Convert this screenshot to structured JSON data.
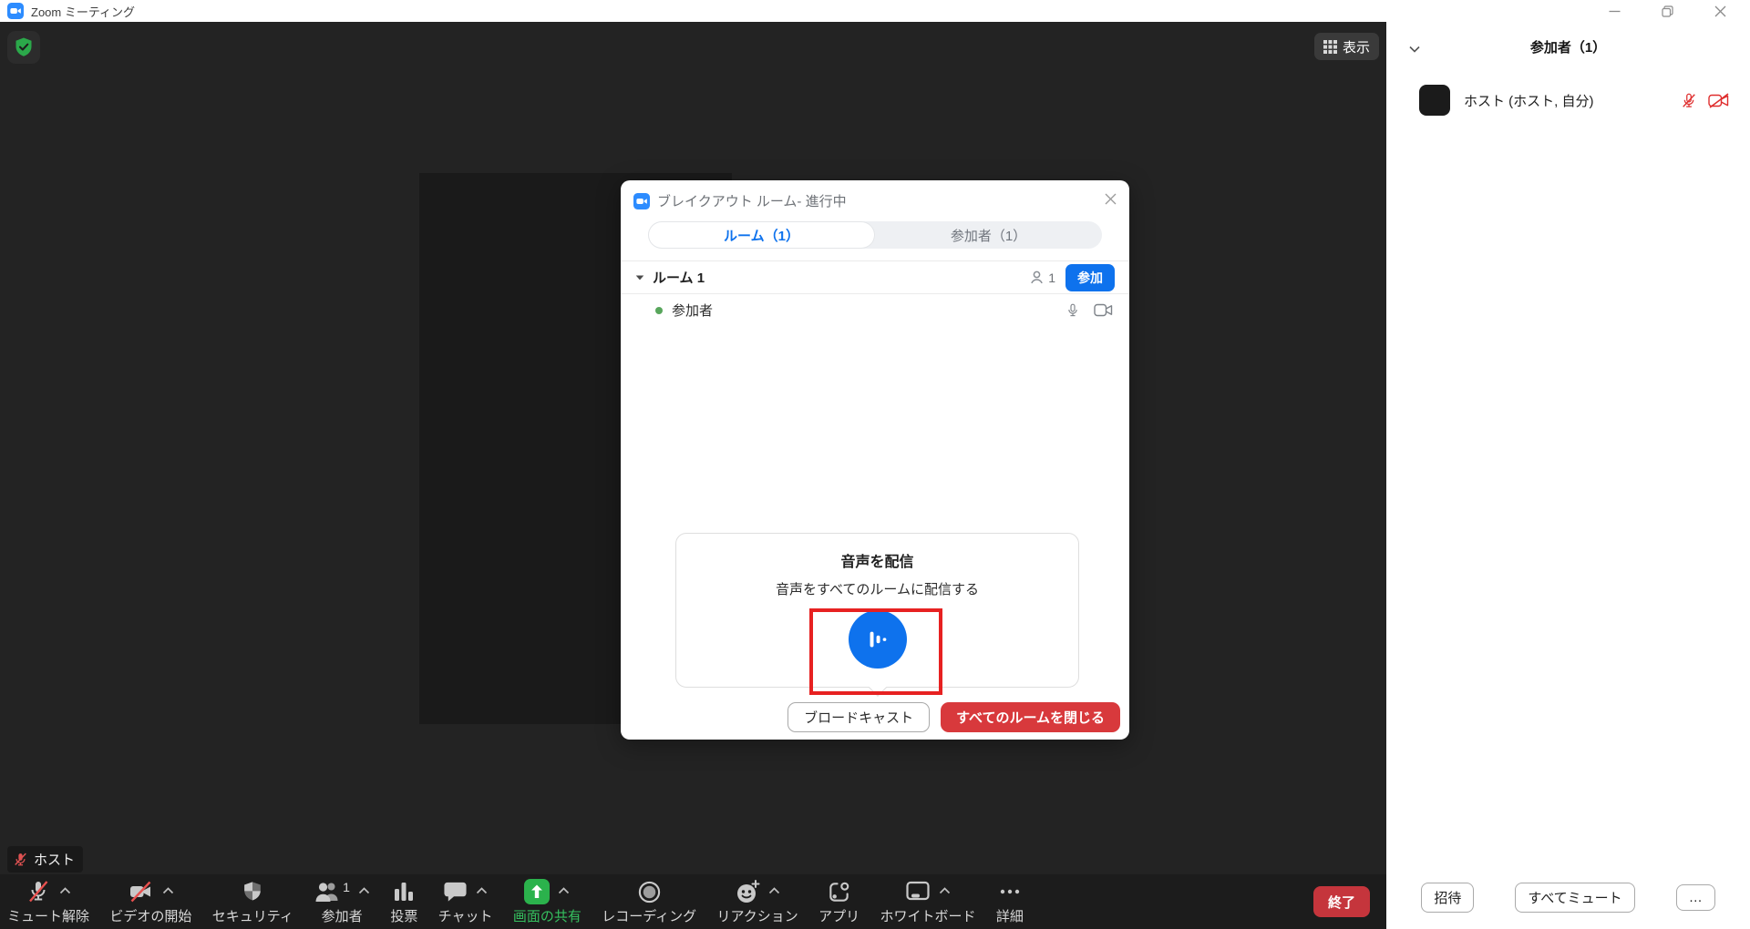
{
  "window": {
    "title": "Zoom ミーティング"
  },
  "stage": {
    "view_label": "表示",
    "host_chip": "ホスト"
  },
  "dialog": {
    "title": "ブレイクアウト ルーム- 進行中",
    "tabs": [
      {
        "label": "ルーム（1）",
        "active": true
      },
      {
        "label": "参加者（1）",
        "active": false
      }
    ],
    "room": {
      "name": "ルーム 1",
      "count": "1",
      "join_label": "参加"
    },
    "participant_label": "参加者",
    "broadcast_panel": {
      "title": "音声を配信",
      "subtitle": "音声をすべてのルームに配信する"
    },
    "footer": {
      "broadcast_label": "ブロードキャスト",
      "close_all_label": "すべてのルームを閉じる"
    }
  },
  "toolbar": {
    "items": [
      {
        "label": "ミュート解除",
        "icon": "mic-muted"
      },
      {
        "label": "ビデオの開始",
        "icon": "video-muted"
      },
      {
        "label": "セキュリティ",
        "icon": "security-shield"
      },
      {
        "label": "参加者",
        "icon": "participants"
      },
      {
        "label": "投票",
        "icon": "polls"
      },
      {
        "label": "チャット",
        "icon": "chat"
      },
      {
        "label": "画面の共有",
        "icon": "share-screen"
      },
      {
        "label": "レコーディング",
        "icon": "record"
      },
      {
        "label": "リアクション",
        "icon": "reactions"
      },
      {
        "label": "アプリ",
        "icon": "apps"
      },
      {
        "label": "ホワイトボード",
        "icon": "whiteboard"
      },
      {
        "label": "詳細",
        "icon": "more"
      }
    ],
    "participants_count": "1",
    "end_label": "終了"
  },
  "sidebar": {
    "header_title": "参加者（1）",
    "participant_name": "ホスト (ホスト, 自分)",
    "footer": {
      "invite_label": "招待",
      "mute_all_label": "すべてミュート",
      "more_label": "…"
    }
  },
  "colors": {
    "accent_blue": "#0e72ed",
    "share_green": "#35c05f",
    "danger_red": "#d8393c",
    "annotation_red": "#e72121",
    "muted_red": "#e8504e",
    "stage_bg": "#232323",
    "toolbar_bg": "#1c1c1c"
  }
}
